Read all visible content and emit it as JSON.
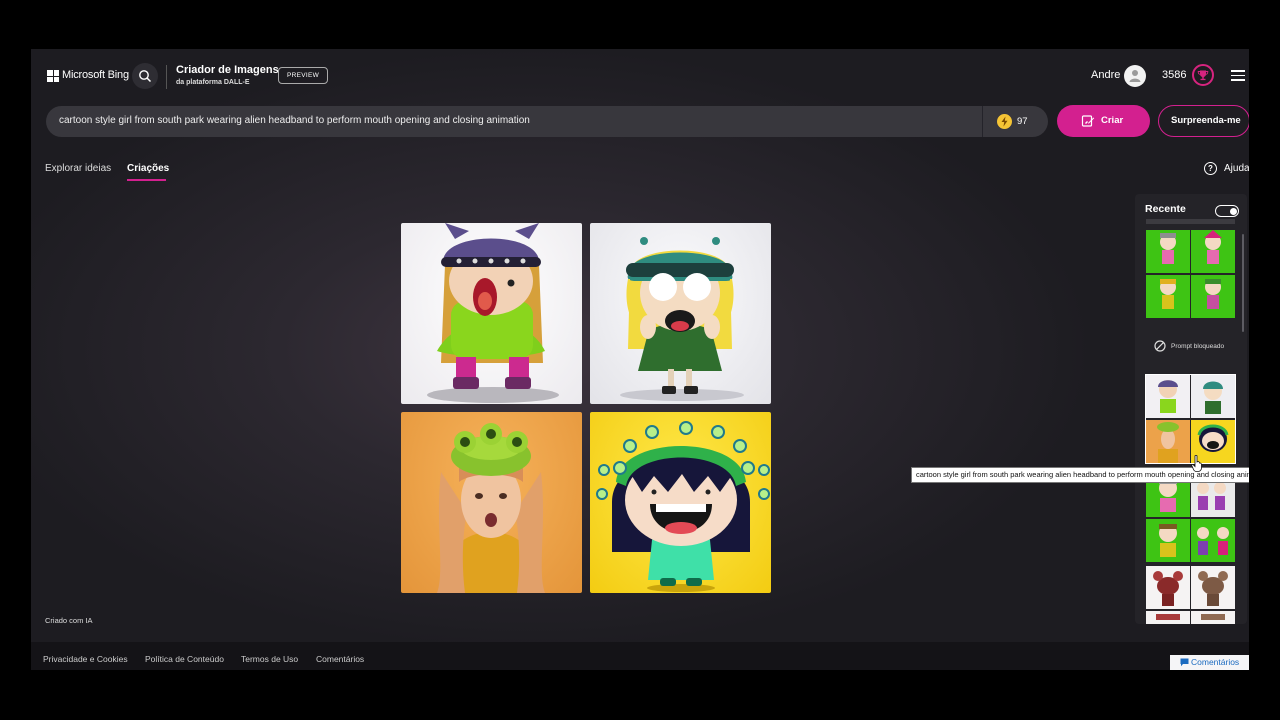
{
  "header": {
    "brand": "Microsoft Bing",
    "product_title": "Criador de Imagens",
    "product_subtitle": "da plataforma DALL-E",
    "preview_badge": "PREVIEW",
    "user_name": "Andre",
    "reward_points": "3586"
  },
  "prompt": {
    "text": "cartoon style girl from south park wearing alien headband to perform mouth opening and closing animation",
    "boosts": "97",
    "create_label": "Criar",
    "surprise_label": "Surpreenda-me"
  },
  "tabs": [
    {
      "label": "Explorar ideias",
      "active": false
    },
    {
      "label": "Criações",
      "active": true
    }
  ],
  "help_label": "Ajuda",
  "images": [
    {
      "id": 1,
      "style": "cartoon-purple-helmet"
    },
    {
      "id": 2,
      "style": "cartoon-teal-helmet"
    },
    {
      "id": 3,
      "style": "photo-girl-alien-headband"
    },
    {
      "id": 4,
      "style": "cartoon-green-antennae"
    }
  ],
  "created_with_ai": "Criado com IA",
  "recent_panel": {
    "title": "Recente",
    "toggle_on": true,
    "blocked_label": "Prompt bloqueado",
    "tooltip": "cartoon style girl from south park wearing alien headband to perform mouth opening and closing animation"
  },
  "footer": {
    "links": [
      "Privacidade e Cookies",
      "Política de Conteúdo",
      "Termos de Uso",
      "Comentários"
    ],
    "feedback_label": "Comentários"
  },
  "colors": {
    "accent": "#d3208f",
    "background": "#2c2830",
    "prompt_bar": "#38373d"
  }
}
